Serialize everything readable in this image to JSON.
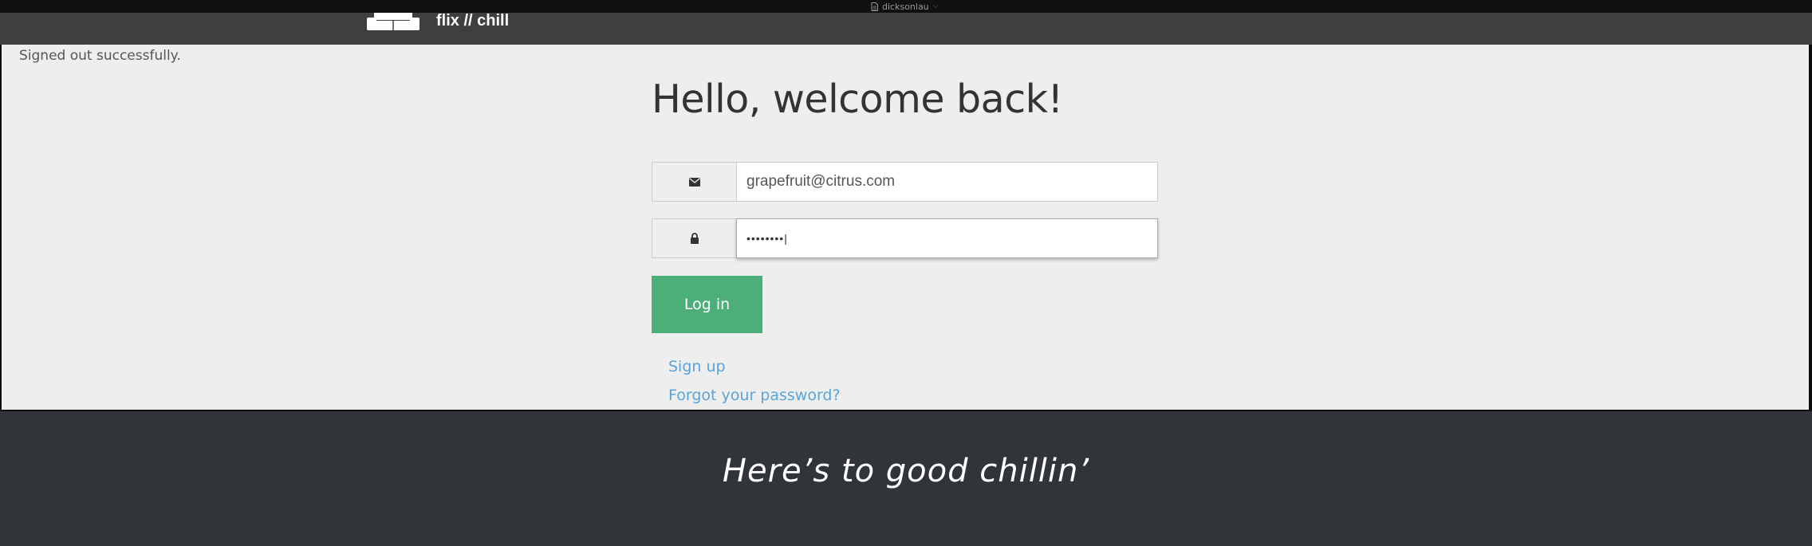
{
  "window": {
    "title": "dicksonlau"
  },
  "nav": {
    "brand_name": "flix // chill"
  },
  "flash": {
    "message": "Signed out successfully."
  },
  "login": {
    "heading": "Hello, welcome back!",
    "email_value": "grapefruit@citrus.com",
    "password_value": "••••••••|",
    "submit_label": "Log in",
    "signup_link": "Sign up",
    "forgot_link": "Forgot your password?"
  },
  "footer": {
    "tagline": "Here’s to good chillin’"
  },
  "colors": {
    "navbar_bg": "#3f3f3f",
    "content_bg": "#eeeeee",
    "button_green": "#4caf7a",
    "link_blue": "#5aa4d8",
    "footer_bg": "#31353a"
  },
  "icons": [
    "document-icon",
    "chevron-down-icon",
    "couch-logo-icon",
    "envelope-icon",
    "lock-icon"
  ]
}
